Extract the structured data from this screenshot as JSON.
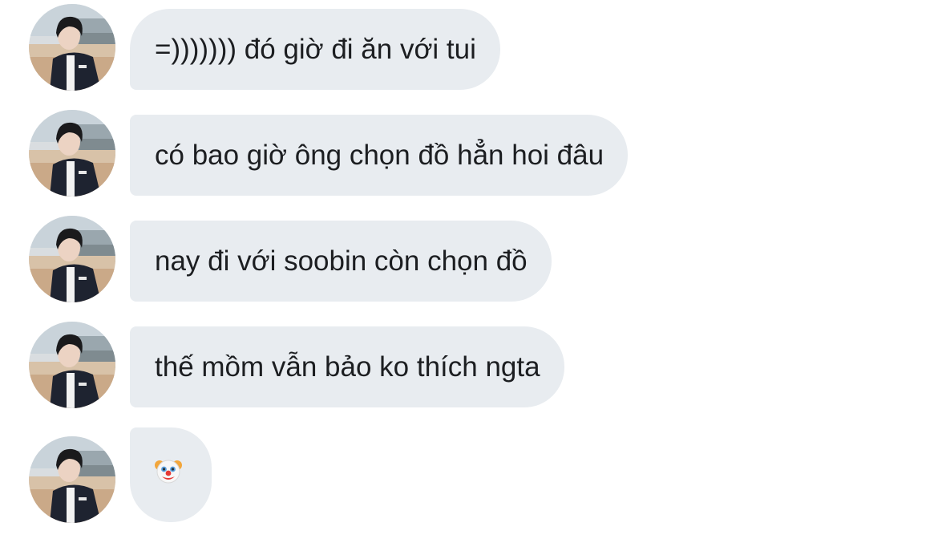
{
  "messages": [
    {
      "text": "=))))))) đó giờ đi ăn với tui"
    },
    {
      "text": "có bao giờ ông chọn đồ hẳn hoi đâu"
    },
    {
      "text": "nay đi với soobin còn chọn đồ"
    },
    {
      "text": "thế mồm vẫn bảo ko thích ngta"
    },
    {
      "emoji": "clown-face"
    }
  ],
  "colors": {
    "bubble_bg": "#e8ecf0",
    "text": "#1c1e21",
    "page_bg": "#ffffff"
  }
}
